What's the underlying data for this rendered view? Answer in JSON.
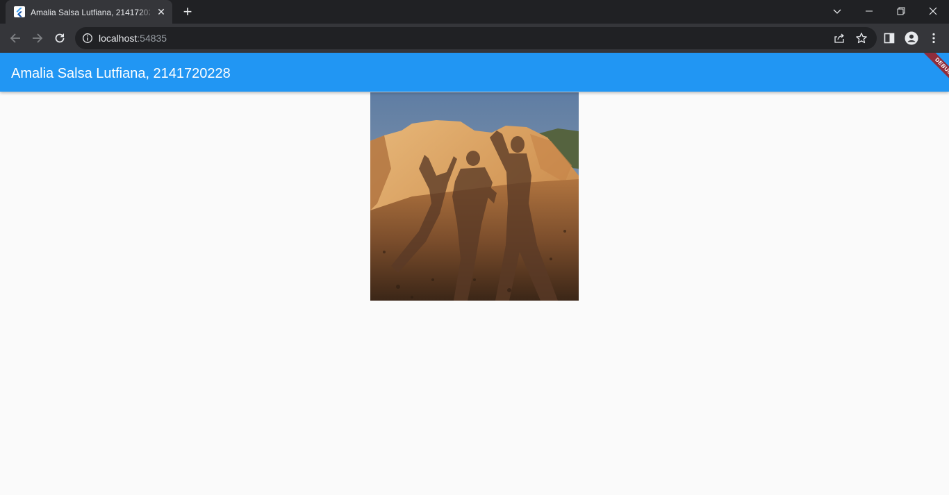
{
  "browser": {
    "tab": {
      "title": "Amalia Salsa Lutfiana, 2141720228",
      "close_glyph": "✕",
      "favicon": "flutter-logo-icon"
    },
    "new_tab_glyph": "+",
    "address_bar": {
      "host": "localhost",
      "port": ":54835"
    },
    "colors": {
      "tabstrip": "#202124",
      "toolbar": "#35363a",
      "omnibox": "#202124"
    }
  },
  "app": {
    "title": "Amalia Salsa Lutfiana, 2141720228",
    "debug_banner": "DEBUG",
    "colors": {
      "app_bar": "#2196f3",
      "background": "#fafafa",
      "debug_banner": "#8f2d3c"
    },
    "image": {
      "description_icon": "photo-shadows-on-rock"
    }
  }
}
